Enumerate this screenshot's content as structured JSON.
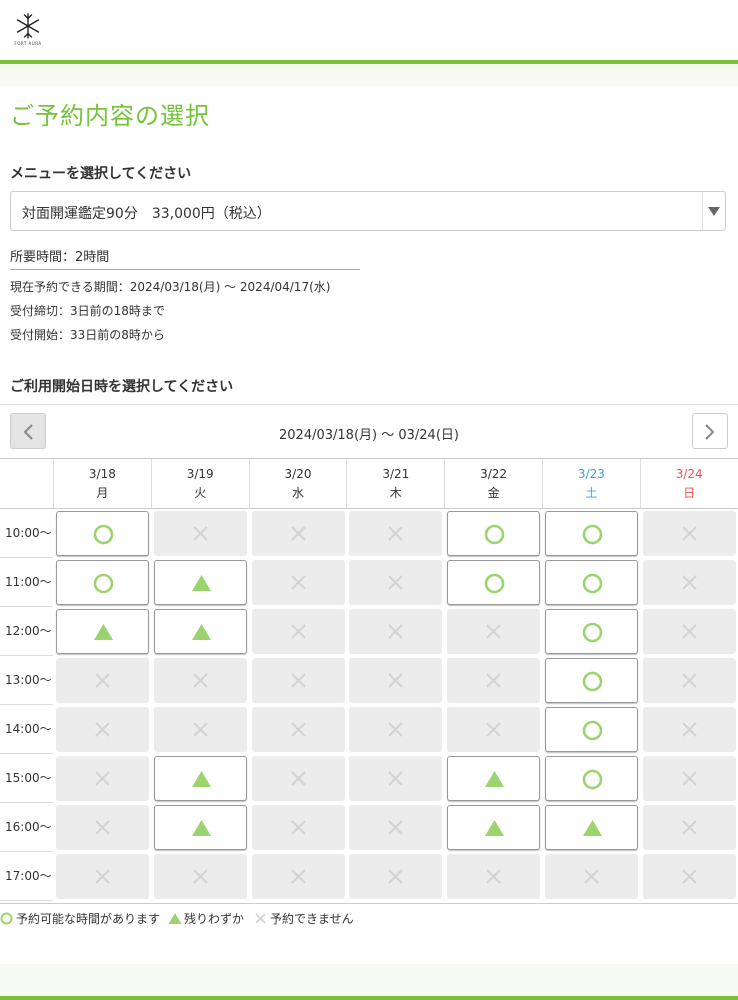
{
  "header": {
    "logo_text": "FORT AURA"
  },
  "page": {
    "title": "ご予約内容の選択",
    "menu_heading": "メニューを選択してください",
    "menu_selected": "対面開運鑑定90分　33,000円（税込）",
    "duration": "所要時間：2時間",
    "info": [
      "現在予約できる期間：2024/03/18(月) 〜 2024/04/17(水)",
      "受付締切：3日前の18時まで",
      "受付開始：33日前の8時から"
    ],
    "date_heading": "ご利用開始日時を選択してください"
  },
  "calendar": {
    "range": "2024/03/18(月) 〜 03/24(日)",
    "days": [
      {
        "date": "3/18",
        "dow": "月",
        "kind": "weekday"
      },
      {
        "date": "3/19",
        "dow": "火",
        "kind": "weekday"
      },
      {
        "date": "3/20",
        "dow": "水",
        "kind": "weekday"
      },
      {
        "date": "3/21",
        "dow": "木",
        "kind": "weekday"
      },
      {
        "date": "3/22",
        "dow": "金",
        "kind": "weekday"
      },
      {
        "date": "3/23",
        "dow": "土",
        "kind": "sat"
      },
      {
        "date": "3/24",
        "dow": "日",
        "kind": "sun"
      }
    ],
    "times": [
      "10:00〜",
      "11:00〜",
      "12:00〜",
      "13:00〜",
      "14:00〜",
      "15:00〜",
      "16:00〜",
      "17:00〜"
    ],
    "availability": [
      [
        "o",
        "x",
        "x",
        "x",
        "o",
        "o",
        "x"
      ],
      [
        "o",
        "t",
        "x",
        "x",
        "o",
        "o",
        "x"
      ],
      [
        "t",
        "t",
        "x",
        "x",
        "x",
        "o",
        "x"
      ],
      [
        "x",
        "x",
        "x",
        "x",
        "x",
        "o",
        "x"
      ],
      [
        "x",
        "x",
        "x",
        "x",
        "x",
        "o",
        "x"
      ],
      [
        "x",
        "t",
        "x",
        "x",
        "t",
        "o",
        "x"
      ],
      [
        "x",
        "t",
        "x",
        "x",
        "t",
        "t",
        "x"
      ],
      [
        "x",
        "x",
        "x",
        "x",
        "x",
        "x",
        "x"
      ]
    ]
  },
  "legend": {
    "available": "予約可能な時間があります",
    "few": "残りわずか",
    "none": "予約できません"
  },
  "colors": {
    "accent": "#75c33a",
    "mark": "#9bd36e",
    "cross": "#d3d3d3",
    "saturday": "#3aa3d8",
    "sunday": "#e8534d"
  }
}
